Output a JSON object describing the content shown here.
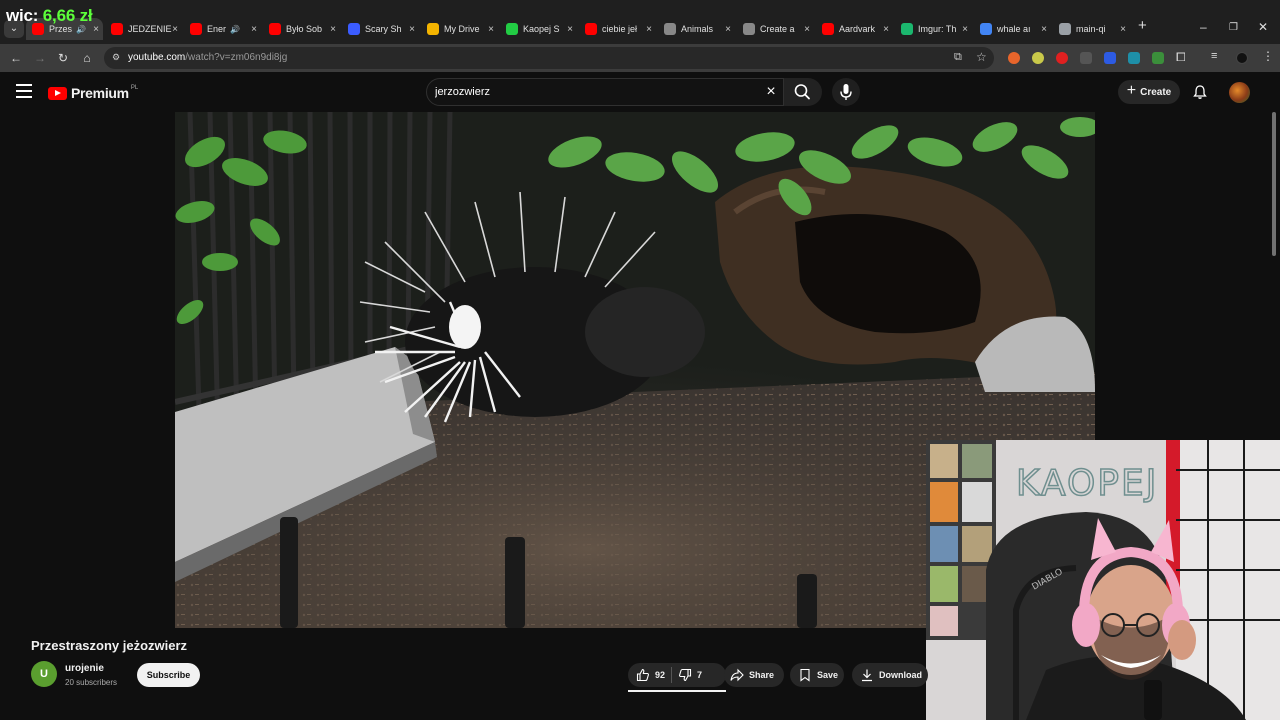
{
  "overlay": {
    "label": "wic:",
    "value": "6,66 zł"
  },
  "tabs": [
    {
      "title": "Przes",
      "sound": true,
      "active": true,
      "favicon_color": "#ff0000"
    },
    {
      "title": "JEDZENIE",
      "sound": false,
      "active": false,
      "favicon_color": "#ff0000"
    },
    {
      "title": "Ener",
      "sound": true,
      "active": false,
      "favicon_color": "#ff0000"
    },
    {
      "title": "Było Sob",
      "sound": false,
      "active": false,
      "favicon_color": "#ff0000"
    },
    {
      "title": "Scary Sh",
      "sound": false,
      "active": false,
      "favicon_color": "#3b5cff"
    },
    {
      "title": "My Drive",
      "sound": false,
      "active": false,
      "favicon_color": "#f4b400"
    },
    {
      "title": "Kaopej S",
      "sound": false,
      "active": false,
      "favicon_color": "#22cc44"
    },
    {
      "title": "ciebie jeł",
      "sound": false,
      "active": false,
      "favicon_color": "#ff0000"
    },
    {
      "title": "Animals",
      "sound": false,
      "active": false,
      "favicon_color": "#888888"
    },
    {
      "title": "Create a",
      "sound": false,
      "active": false,
      "favicon_color": "#888888"
    },
    {
      "title": "Aardvark",
      "sound": false,
      "active": false,
      "favicon_color": "#ff0000"
    },
    {
      "title": "Imgur: Th",
      "sound": false,
      "active": false,
      "favicon_color": "#1bb76e"
    },
    {
      "title": "whale aı",
      "sound": false,
      "active": false,
      "favicon_color": "#4285f4"
    },
    {
      "title": "main-qi",
      "sound": false,
      "active": false,
      "favicon_color": "#9aa0a6"
    }
  ],
  "address_bar": {
    "host": "youtube.com",
    "path": "/watch?v=zm06n9di8jg"
  },
  "header": {
    "logo_text": "Premium",
    "logo_badge": "PL",
    "search_value": "jerzozwierz",
    "create_label": "Create"
  },
  "video": {
    "title": "Przestraszony jeżozwierz",
    "channel": "urojenie",
    "channel_initial": "U",
    "subscribers": "20 subscribers",
    "subscribe_label": "Subscribe",
    "likes": "92",
    "dislikes": "7",
    "share_label": "Share",
    "save_label": "Save",
    "download_label": "Download"
  },
  "webcam": {
    "sign_text": "KAOPEJ",
    "chair_text": "DIABLO"
  },
  "colors": {
    "accent": "#ff0000",
    "price": "#5cff3a",
    "avatar": "#5a9e2f"
  }
}
